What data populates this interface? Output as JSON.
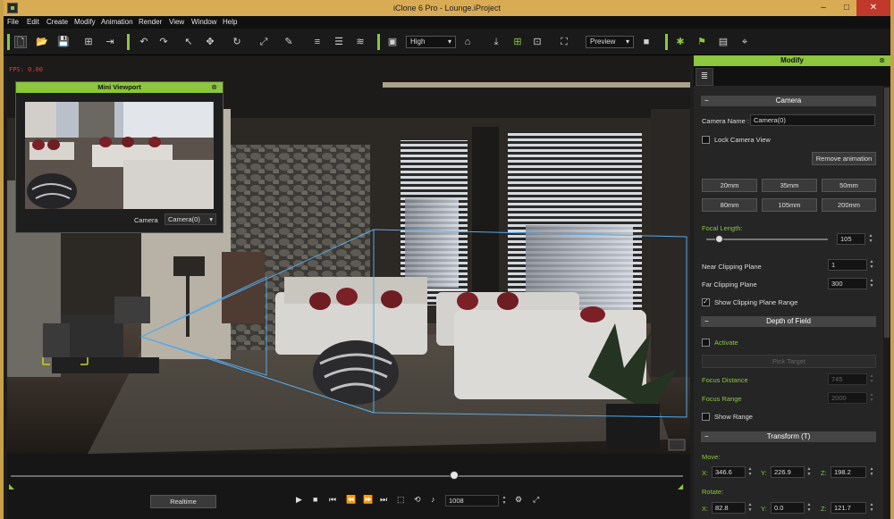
{
  "window": {
    "title": "iClone 6 Pro - Lounge.iProject"
  },
  "menu": [
    "File",
    "Edit",
    "Create",
    "Modify",
    "Animation",
    "Render",
    "View",
    "Window",
    "Help"
  ],
  "toolbar": {
    "quality": "High",
    "render_mode": "Preview"
  },
  "viewport": {
    "fps": "FPS: 0.00"
  },
  "mini_viewport": {
    "title": "Mini Viewport",
    "camera_label": "Camera",
    "camera_value": "Camera(0)"
  },
  "modify_panel": {
    "title": "Modify",
    "camera_section": "Camera",
    "camera_name_label": "Camera Name :",
    "camera_name_value": "Camera(0)",
    "lock_camera_label": "Lock Camera View",
    "remove_animation_label": "Remove  animation",
    "lens_presets": [
      "20mm",
      "35mm",
      "50mm",
      "80mm",
      "105mm",
      "200mm"
    ],
    "focal_length_label": "Focal Length:",
    "focal_length_value": "105",
    "focal_length_fraction": 0.1,
    "near_clip_label": "Near Clipping Plane",
    "near_clip_value": "1",
    "far_clip_label": "Far Clipping Plane",
    "far_clip_value": "300",
    "show_clip_label": "Show Clipping Plane Range",
    "dof_section": "Depth of Field",
    "activate_label": "Activate",
    "pick_target_label": "Pick Target",
    "focus_distance_label": "Focus Distance",
    "focus_distance_value": "745",
    "focus_range_label": "Focus Range",
    "focus_range_value": "2000",
    "show_range_label": "Show Range",
    "transform_section": "Transform  (T)",
    "move_label": "Move:",
    "move": {
      "x": "346.6",
      "y": "226.9",
      "z": "198.2"
    },
    "rotate_label": "Rotate:",
    "rotate": {
      "x": "82.8",
      "y": "0.0",
      "z": "121.7"
    }
  },
  "timeline": {
    "realtime_label": "Realtime",
    "frame_value": "1008",
    "playhead_fraction": 0.66
  },
  "colors": {
    "accent": "#8dc63f",
    "title_bar": "#d9ab55",
    "close": "#c0392b"
  }
}
